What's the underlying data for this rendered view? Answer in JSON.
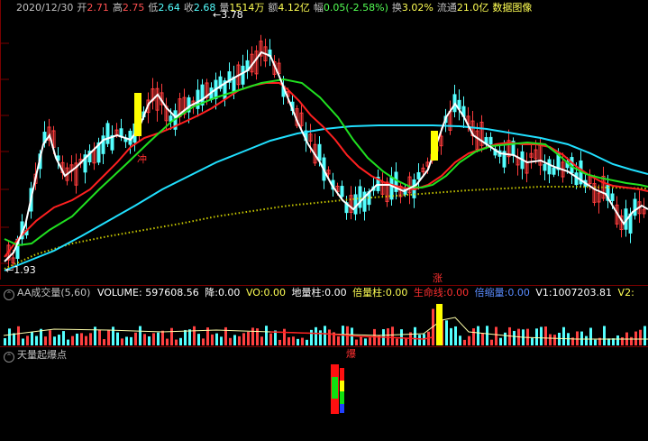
{
  "info_bar": {
    "date": "2020/12/30",
    "open_label": "开",
    "open_value": "2.71",
    "high_label": "高",
    "high_value": "2.75",
    "low_label": "低",
    "low_value": "2.64",
    "close_label": "收",
    "close_value": "2.68",
    "volume_label": "量",
    "volume_value": "1514万",
    "amount_label": "额",
    "amount_value": "4.12亿",
    "change_label": "幅",
    "change_value": "0.05(-2.58%)",
    "turnover_label": "换",
    "turnover_value": "3.02%",
    "float_label": "流通",
    "float_value": "21.0亿",
    "indicator_name": "数据图像"
  },
  "price_chart": {
    "high_marker": "3.78",
    "low_marker": "1.93",
    "signal_label_chong": "冲",
    "signal_label_zhang": "涨"
  },
  "volume_panel": {
    "collapse_icon": "⌃",
    "title": "AA成交量(5,60)",
    "volume_label": "VOLUME:",
    "volume_value": "597608.56",
    "jiang_label": "降:",
    "jiang_value": "0.00",
    "vo_label": "VO:",
    "vo_value": "0.00",
    "dilizhu_label": "地量柱:",
    "dilizhu_value": "0.00",
    "beilizhu_label": "倍量柱:",
    "beilizhu_value": "0.00",
    "shengming_label": "生命线:",
    "shengming_value": "0.00",
    "beisuoliang_label": "倍缩量:",
    "beisuoliang_value": "0.00",
    "v1_label": "V1:",
    "v1_value": "1007203.81",
    "v2_label": "V2:"
  },
  "bottom_panel": {
    "collapse_icon": "⌃",
    "title": "天量起爆点",
    "signal_label": "爆"
  },
  "colors": {
    "background": "#000000",
    "up": "#ff3c3c",
    "down": "#54ffff",
    "ma_white": "#ffffff",
    "ma_red": "#ff2020",
    "ma_green": "#20e020",
    "ma_cyan": "#20e0ff",
    "ma_dotted": "#c8c800",
    "signal_yellow": "#ffff00",
    "panel_border": "#7a0000"
  }
}
